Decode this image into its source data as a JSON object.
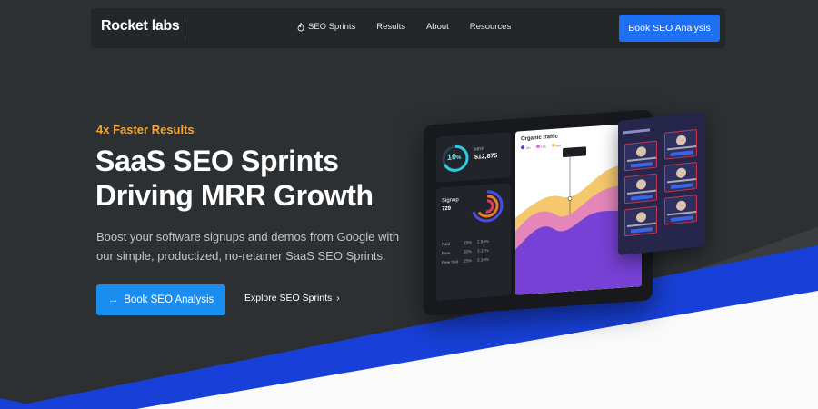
{
  "nav": {
    "brand": "Rocket labs",
    "links": [
      "SEO Sprints",
      "Results",
      "About",
      "Resources"
    ],
    "cta_label": "Book SEO Analysis"
  },
  "hero": {
    "eyebrow": "4x Faster Results",
    "headline_line1": "SaaS SEO Sprints",
    "headline_line2": "Driving MRR Growth",
    "subtext": "Boost your software signups and demos from Google with our simple, productized, no-retainer SaaS SEO Sprints.",
    "primary_cta_arrow": "→",
    "primary_cta_label": "Book SEO Analysis",
    "secondary_cta_label": "Explore SEO Sprints",
    "secondary_cta_chevron": "›"
  },
  "dashboard": {
    "mrr_label": "MRR",
    "mrr_value": "$12,875",
    "gauge_value": "10",
    "gauge_unit": "%",
    "signup_label": "Signup",
    "signup_value": "729",
    "stat_rows": [
      {
        "label": "Paid",
        "a": "15%",
        "b": "2.54%"
      },
      {
        "label": "Free",
        "a": "20%",
        "b": "3.11%"
      },
      {
        "label": "Free trial",
        "a": "25%",
        "b": "3.14%"
      }
    ],
    "chart_title": "Organic traffic",
    "legend": [
      "Jan",
      "Feb",
      "Mar"
    ]
  },
  "colors": {
    "accent": "#1e6ff2",
    "eyebrow": "#f0a43a",
    "background": "#2d3033",
    "navbar": "#24272a"
  }
}
